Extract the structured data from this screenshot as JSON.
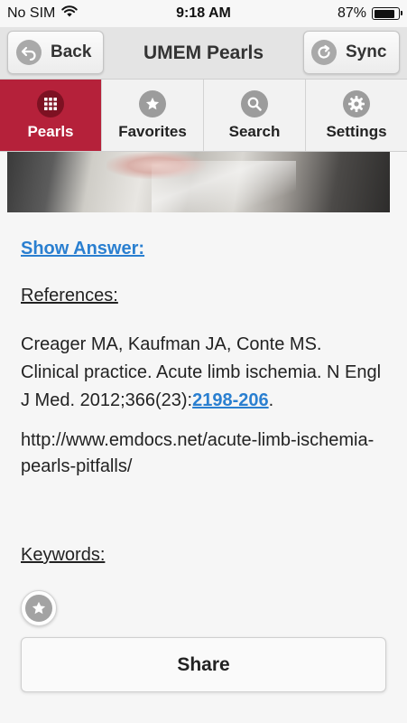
{
  "status_bar": {
    "carrier": "No SIM",
    "time": "9:18 AM",
    "battery_percent": "87%",
    "battery_level": 0.87
  },
  "header": {
    "back_label": "Back",
    "title": "UMEM Pearls",
    "sync_label": "Sync"
  },
  "tabs": [
    {
      "label": "Pearls",
      "icon": "grid-icon",
      "active": true
    },
    {
      "label": "Favorites",
      "icon": "star-icon",
      "active": false
    },
    {
      "label": "Search",
      "icon": "search-icon",
      "active": false
    },
    {
      "label": "Settings",
      "icon": "gear-icon",
      "active": false
    }
  ],
  "content": {
    "show_answer": "Show Answer:",
    "references_label": "References:",
    "reference_text": "Creager MA, Kaufman JA, Conte MS. Clinical practice. Acute limb ischemia. N Engl J Med. 2012;366(23):",
    "reference_link": "2198-206",
    "reference_suffix": ".",
    "url": "http://www.emdocs.net/acute-limb-ischemia-pearls-pitfalls/",
    "keywords_label": "Keywords:",
    "share_label": "Share"
  },
  "colors": {
    "accent": "#b5213a",
    "link": "#2a7fd0"
  }
}
